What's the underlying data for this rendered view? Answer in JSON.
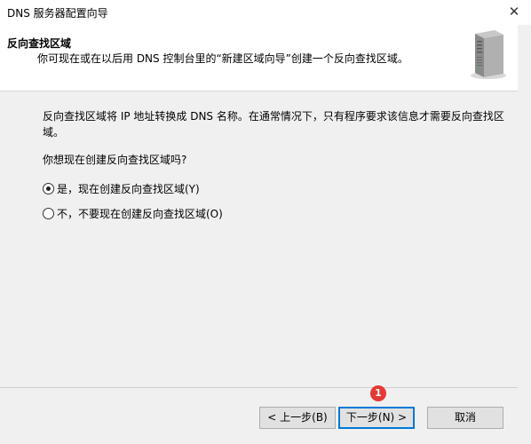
{
  "window": {
    "title": "DNS 服务器配置向导",
    "close_glyph": "✕"
  },
  "header": {
    "title": "反向查找区域",
    "subtitle": "你可现在或在以后用 DNS 控制台里的“新建区域向导”创建一个反向查找区域。",
    "icon": "server-icon"
  },
  "content": {
    "description": "反向查找区域将 IP 地址转换成 DNS 名称。在通常情况下，只有程序要求该信息才需要反向查找区域。",
    "question": "你想现在创建反向查找区域吗?",
    "options": [
      {
        "label": "是，现在创建反向查找区域(Y)",
        "selected": true
      },
      {
        "label": "不，不要现在创建反向查找区域(O)",
        "selected": false
      }
    ]
  },
  "buttons": {
    "back": "< 上一步(B)",
    "next": "下一步(N) >",
    "cancel": "取消"
  },
  "annotation": {
    "badge": "1",
    "color": "#e53935"
  }
}
